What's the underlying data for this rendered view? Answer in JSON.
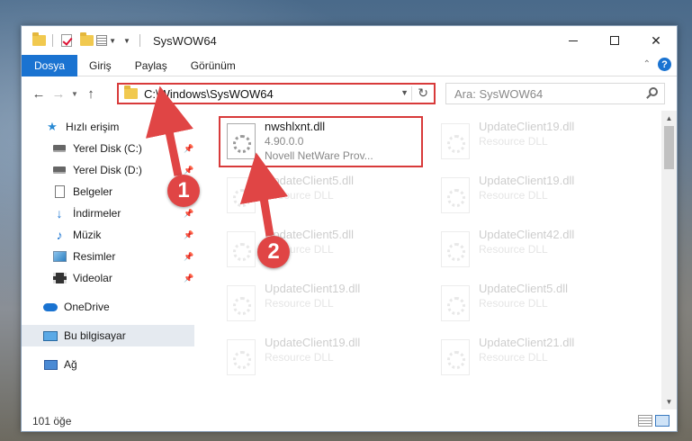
{
  "window": {
    "title": "SysWOW64"
  },
  "ribbon": {
    "tabs": [
      {
        "label": "Dosya",
        "active": true
      },
      {
        "label": "Giriş"
      },
      {
        "label": "Paylaş"
      },
      {
        "label": "Görünüm"
      }
    ],
    "help": "?"
  },
  "address": {
    "path": "C:\\Windows\\SysWOW64"
  },
  "search": {
    "placeholder": "Ara: SysWOW64"
  },
  "sidebar": {
    "items": [
      {
        "label": "Hızlı erişim",
        "icon": "star-icon"
      },
      {
        "label": "Yerel Disk (C:)",
        "icon": "drive-icon",
        "pinned": true
      },
      {
        "label": "Yerel Disk (D:)",
        "icon": "drive-icon",
        "pinned": true
      },
      {
        "label": "Belgeler",
        "icon": "documents-icon",
        "pinned": true
      },
      {
        "label": "İndirmeler",
        "icon": "downloads-icon",
        "pinned": true
      },
      {
        "label": "Müzik",
        "icon": "music-icon",
        "pinned": true
      },
      {
        "label": "Resimler",
        "icon": "pictures-icon",
        "pinned": true
      },
      {
        "label": "Videolar",
        "icon": "videos-icon",
        "pinned": true
      },
      {
        "label": "OneDrive",
        "icon": "onedrive-icon"
      },
      {
        "label": "Bu bilgisayar",
        "icon": "this-pc-icon",
        "selected": true
      },
      {
        "label": "Ağ",
        "icon": "network-icon"
      }
    ]
  },
  "files": [
    {
      "name": "nwshlxnt.dll",
      "line2": "4.90.0.0",
      "line3": "Novell NetWare Prov..."
    },
    {
      "name": "UpdateClient19.dll",
      "line2": "Resource DLL"
    },
    {
      "name": "UpdateClient5.dll",
      "line2": "Resource DLL"
    },
    {
      "name": "UpdateClient19.dll",
      "line2": "Resource DLL"
    },
    {
      "name": "UpdateClient5.dll",
      "line2": "Resource DLL"
    },
    {
      "name": "UpdateClient42.dll",
      "line2": "Resource DLL"
    },
    {
      "name": "UpdateClient19.dll",
      "line2": "Resource DLL"
    },
    {
      "name": "UpdateClient5.dll",
      "line2": "Resource DLL"
    },
    {
      "name": "UpdateClient19.dll",
      "line2": "Resource DLL"
    },
    {
      "name": "UpdateClient21.dll",
      "line2": "Resource DLL"
    }
  ],
  "status": {
    "count": "101 öğe"
  },
  "callouts": {
    "one": "1",
    "two": "2"
  },
  "colors": {
    "accent": "#1a73d1",
    "highlight": "#d83a3a",
    "callout": "#e04545"
  }
}
